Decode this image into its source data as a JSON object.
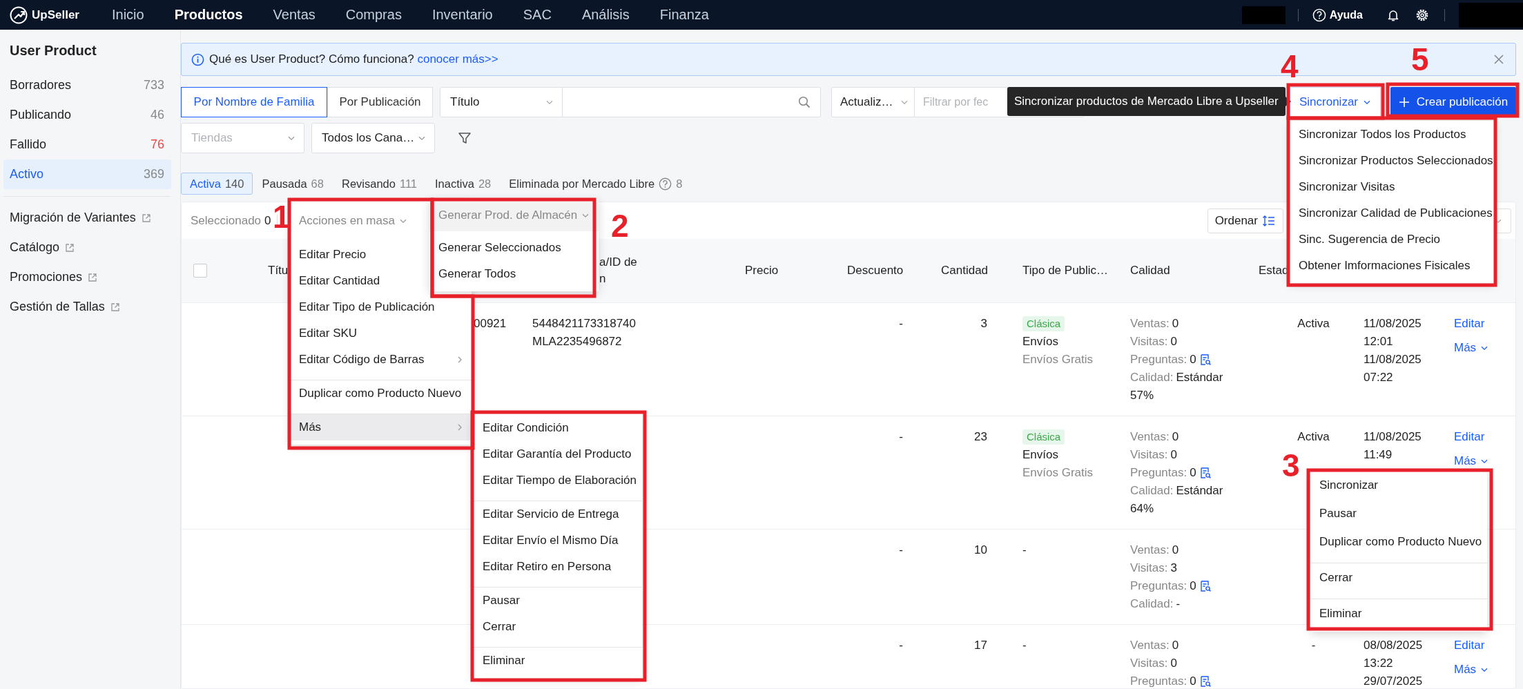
{
  "top_nav": {
    "brand": "UpSeller",
    "items": [
      {
        "label": "Inicio",
        "selected": false
      },
      {
        "label": "Productos",
        "selected": true
      },
      {
        "label": "Ventas",
        "selected": false
      },
      {
        "label": "Compras",
        "selected": false
      },
      {
        "label": "Inventario",
        "selected": false
      },
      {
        "label": "SAC",
        "selected": false
      },
      {
        "label": "Análisis",
        "selected": false
      },
      {
        "label": "Finanza",
        "selected": false
      }
    ],
    "help": "Ayuda"
  },
  "sidebar": {
    "title": "User Product",
    "items": [
      {
        "label": "Borradores",
        "count": "733",
        "selected": false,
        "alert": false
      },
      {
        "label": "Publicando",
        "count": "46",
        "selected": false,
        "alert": false
      },
      {
        "label": "Fallido",
        "count": "76",
        "selected": false,
        "alert": true
      },
      {
        "label": "Activo",
        "count": "369",
        "selected": true,
        "alert": false
      }
    ],
    "links": [
      {
        "label": "Migración de Variantes"
      },
      {
        "label": "Catálogo"
      },
      {
        "label": "Promociones"
      },
      {
        "label": "Gestión de Tallas"
      }
    ]
  },
  "banner": {
    "text": "Qué es User Product? Cómo funciona?",
    "link": "conocer más>>"
  },
  "filters": {
    "modes": [
      {
        "label": "Por Nombre de Familia",
        "selected": true
      },
      {
        "label": "Por Publicación",
        "selected": false
      }
    ],
    "search_by": "Título",
    "date_by": "Actualiz…",
    "date_field": {
      "placeholder": "Filtrar por fec"
    },
    "store_field": {
      "placeholder": "Tiendas"
    },
    "channel_select": "Todos los Cana…",
    "sync_button": "Sincronizar",
    "create_button": "Crear publicación"
  },
  "tooltip": "Sincronizar productos de Mercado Libre a Upseller",
  "sync_menu": {
    "items": [
      {
        "label": "Sincronizar Todos los Productos",
        "divider_before": false,
        "highlighted": false
      },
      {
        "label": "Sincronizar Productos Seleccionados",
        "divider_before": false,
        "highlighted": false
      },
      {
        "label": "Sincronizar Visitas",
        "divider_before": false,
        "highlighted": false
      },
      {
        "label": "Sincronizar Calidad de Publicaciones",
        "divider_before": false,
        "highlighted": false
      },
      {
        "label": "Sinc. Sugerencia de Precio",
        "divider_before": false,
        "highlighted": false
      },
      {
        "label": "Obtener Imformaciones Fisicales",
        "divider_before": false,
        "highlighted": false
      }
    ]
  },
  "status_tabs": [
    {
      "label": "Activa",
      "count": "140",
      "selected": true,
      "help": false
    },
    {
      "label": "Pausada",
      "count": "68",
      "selected": false,
      "help": false
    },
    {
      "label": "Revisando",
      "count": "111",
      "selected": false,
      "help": false
    },
    {
      "label": "Inactiva",
      "count": "28",
      "selected": false,
      "help": false
    },
    {
      "label": "Eliminada por Mercado Libre",
      "count": "8",
      "selected": false,
      "help": true
    }
  ],
  "toolbar": {
    "selected_label": "Seleccionado",
    "selected_count": "0",
    "sort_button": "Ordenar"
  },
  "bulk_actions": {
    "label": "Acciones en masa",
    "items": [
      {
        "kind": "action",
        "label": "Editar Precio",
        "divider_before": false,
        "highlighted": false
      },
      {
        "kind": "action",
        "label": "Editar Cantidad",
        "divider_before": false,
        "highlighted": false
      },
      {
        "kind": "action",
        "label": "Editar Tipo de Publicación",
        "divider_before": false,
        "highlighted": false
      },
      {
        "kind": "action",
        "label": "Editar SKU",
        "divider_before": false,
        "highlighted": false
      },
      {
        "kind": "submenu",
        "label": "Editar Código de Barras",
        "divider_before": false,
        "highlighted": false
      },
      {
        "kind": "action",
        "label": "Duplicar como Producto Nuevo",
        "divider_before": true,
        "highlighted": false
      },
      {
        "kind": "submenu",
        "label": "Más",
        "divider_before": true,
        "highlighted": true
      }
    ]
  },
  "warehouse_generation": {
    "label": "Generar Prod. de Almacén",
    "items": [
      {
        "label": "Generar Seleccionados",
        "divider_before": false,
        "highlighted": false
      },
      {
        "label": "Generar Todos",
        "divider_before": false,
        "highlighted": false
      }
    ]
  },
  "more_submenu": {
    "items": [
      {
        "label": "Editar Condición",
        "divider_before": false,
        "highlighted": false
      },
      {
        "label": "Editar Garantía del Producto",
        "divider_before": false,
        "highlighted": false
      },
      {
        "label": "Editar Tiempo de Elaboración",
        "divider_before": false,
        "highlighted": false
      },
      {
        "label": "Editar Servicio de Entrega",
        "divider_before": true,
        "highlighted": false
      },
      {
        "label": "Editar Envío el Mismo Día",
        "divider_before": false,
        "highlighted": false
      },
      {
        "label": "Editar Retiro en Persona",
        "divider_before": false,
        "highlighted": false
      },
      {
        "label": "Pausar",
        "divider_before": true,
        "highlighted": false
      },
      {
        "label": "Cerrar",
        "divider_before": false,
        "highlighted": false
      },
      {
        "label": "Eliminar",
        "divider_before": true,
        "highlighted": false
      }
    ]
  },
  "table": {
    "select_all": {
      "checked": false
    },
    "columns": [
      {
        "label": "Títu"
      },
      {
        "label": "a/ID de\nn"
      },
      {
        "label": "Precio"
      },
      {
        "label": "Descuento"
      },
      {
        "label": "Cantidad"
      },
      {
        "label": "Tipo de Public…"
      },
      {
        "label": "Calidad"
      },
      {
        "label": "Estad"
      }
    ],
    "rows": [
      {
        "sku": "00921",
        "ids": [
          "5448421173318740",
          "MLA2235496872"
        ],
        "discount": "-",
        "quantity": "3",
        "listing": {
          "kind": "tag",
          "tag": "Clásica",
          "shipping": "Envíos",
          "shipping_note": "Envíos Gratis"
        },
        "stats": [
          {
            "kind": "plain",
            "label": "Ventas:",
            "value": "0"
          },
          {
            "kind": "plain",
            "label": "Visitas:",
            "value": "0"
          },
          {
            "kind": "questions",
            "label": "Preguntas:",
            "value": "0"
          },
          {
            "kind": "plain",
            "label": "Calidad:",
            "value": "Estándar",
            "extra": "57%"
          }
        ],
        "status": "Activa",
        "dates": [
          "11/08/2025",
          "12:01",
          "11/08/2025",
          "07:22"
        ],
        "actions": {
          "edit": "Editar",
          "more": "Más"
        }
      },
      {
        "discount": "-",
        "quantity": "23",
        "listing": {
          "kind": "tag",
          "tag": "Clásica",
          "shipping": "Envíos",
          "shipping_note": "Envíos Gratis"
        },
        "stats": [
          {
            "kind": "plain",
            "label": "Ventas:",
            "value": "0"
          },
          {
            "kind": "plain",
            "label": "Visitas:",
            "value": "0"
          },
          {
            "kind": "questions",
            "label": "Preguntas:",
            "value": "0"
          },
          {
            "kind": "plain",
            "label": "Calidad:",
            "value": "Estándar",
            "extra": "64%"
          }
        ],
        "status": "Activa",
        "dates": [
          "11/08/2025",
          "11:49"
        ],
        "actions": {
          "edit": "Editar",
          "more": "Más"
        }
      },
      {
        "discount": "-",
        "quantity": "10",
        "listing": {
          "kind": "text",
          "text": "-"
        },
        "stats": [
          {
            "kind": "plain",
            "label": "Ventas:",
            "value": "0"
          },
          {
            "kind": "plain",
            "label": "Visitas:",
            "value": "3"
          },
          {
            "kind": "questions",
            "label": "Preguntas:",
            "value": "0"
          },
          {
            "kind": "plain",
            "label": "Calidad:",
            "value": "-"
          }
        ]
      },
      {
        "discount": "-",
        "quantity": "17",
        "listing": {
          "kind": "text",
          "text": "-"
        },
        "stats": [
          {
            "kind": "plain",
            "label": "Ventas:",
            "value": "0"
          },
          {
            "kind": "plain",
            "label": "Visitas:",
            "value": "0"
          },
          {
            "kind": "questions",
            "label": "Preguntas:",
            "value": "0"
          }
        ],
        "status": "-",
        "dates": [
          "08/08/2025",
          "13:22",
          "29/07/2025"
        ],
        "actions": {
          "edit": "Editar",
          "more": "Más"
        }
      }
    ]
  },
  "row_actions_menu": {
    "items": [
      {
        "label": "Sincronizar",
        "divider_before": false,
        "highlighted": false
      },
      {
        "label": "Pausar",
        "divider_before": false,
        "highlighted": false
      },
      {
        "label": "Duplicar como Producto Nuevo",
        "divider_before": false,
        "highlighted": false
      },
      {
        "label": "Cerrar",
        "divider_before": true,
        "highlighted": false
      },
      {
        "label": "Eliminar",
        "divider_before": true,
        "highlighted": false
      }
    ]
  },
  "annotations": [
    {
      "label": "1"
    },
    {
      "label": "2"
    },
    {
      "label": "3"
    },
    {
      "label": "4"
    },
    {
      "label": "5"
    }
  ]
}
